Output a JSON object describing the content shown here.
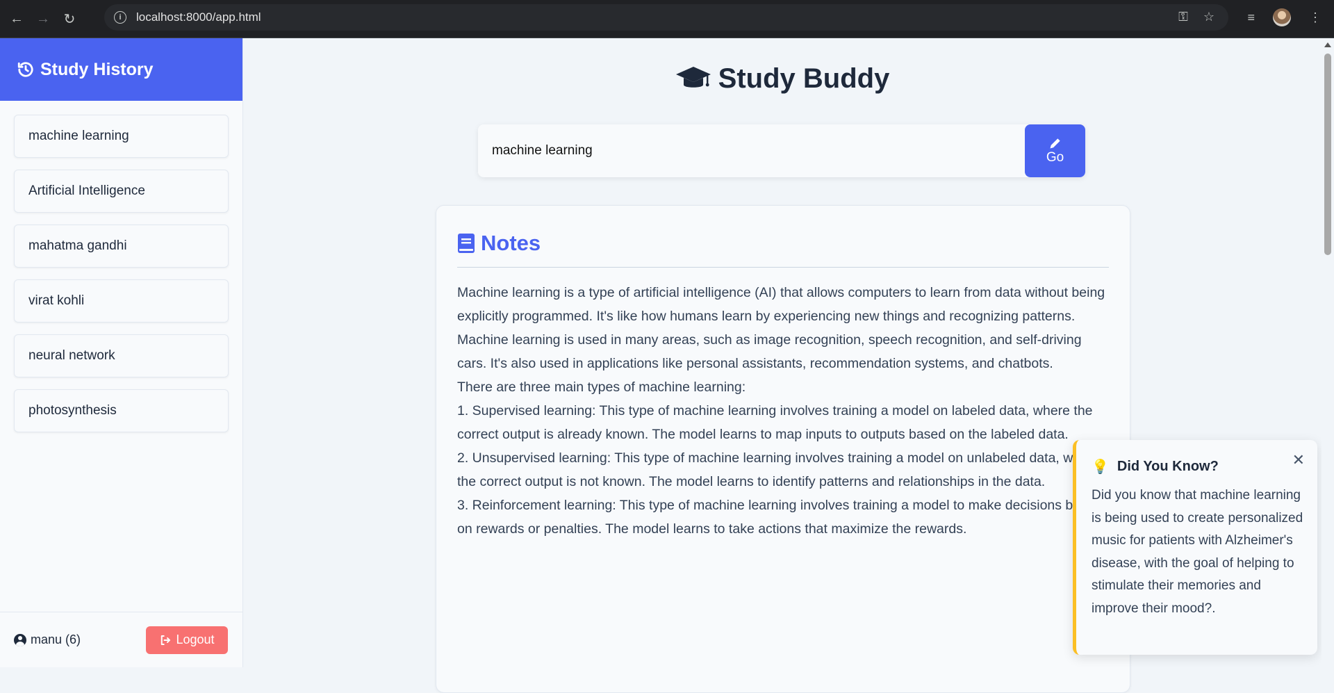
{
  "browser": {
    "url": "localhost:8000/app.html"
  },
  "sidebar": {
    "title": "Study History",
    "items": [
      {
        "label": "machine learning"
      },
      {
        "label": "Artificial Intelligence"
      },
      {
        "label": "mahatma gandhi"
      },
      {
        "label": "virat kohli"
      },
      {
        "label": "neural network"
      },
      {
        "label": "photosynthesis"
      }
    ],
    "user": "manu (6)",
    "logout_label": "Logout"
  },
  "main": {
    "title": "Study Buddy",
    "search_value": "machine learning",
    "go_label": "Go",
    "notes": {
      "title": "Notes",
      "paragraphs": [
        "Machine learning is a type of artificial intelligence (AI) that allows computers to learn from data without being explicitly programmed. It's like how humans learn by experiencing new things and recognizing patterns.",
        "Machine learning is used in many areas, such as image recognition, speech recognition, and self-driving cars. It's also used in applications like personal assistants, recommendation systems, and chatbots.",
        "There are three main types of machine learning:",
        "1. Supervised learning: This type of machine learning involves training a model on labeled data, where the correct output is already known. The model learns to map inputs to outputs based on the labeled data.",
        "2. Unsupervised learning: This type of machine learning involves training a model on unlabeled data, where the correct output is not known. The model learns to identify patterns and relationships in the data.",
        "3. Reinforcement learning: This type of machine learning involves training a model to make decisions based on rewards or penalties. The model learns to take actions that maximize the rewards."
      ]
    }
  },
  "fact": {
    "icon": "💡",
    "title": "Did You Know?",
    "text": "Did you know that machine learning is being used to create personalized music for patients with Alzheimer's disease, with the goal of helping to stimulate their memories and improve their mood?."
  },
  "colors": {
    "accent": "#4a63f0",
    "logout": "#f87171",
    "fact_border": "#fbbf24"
  }
}
